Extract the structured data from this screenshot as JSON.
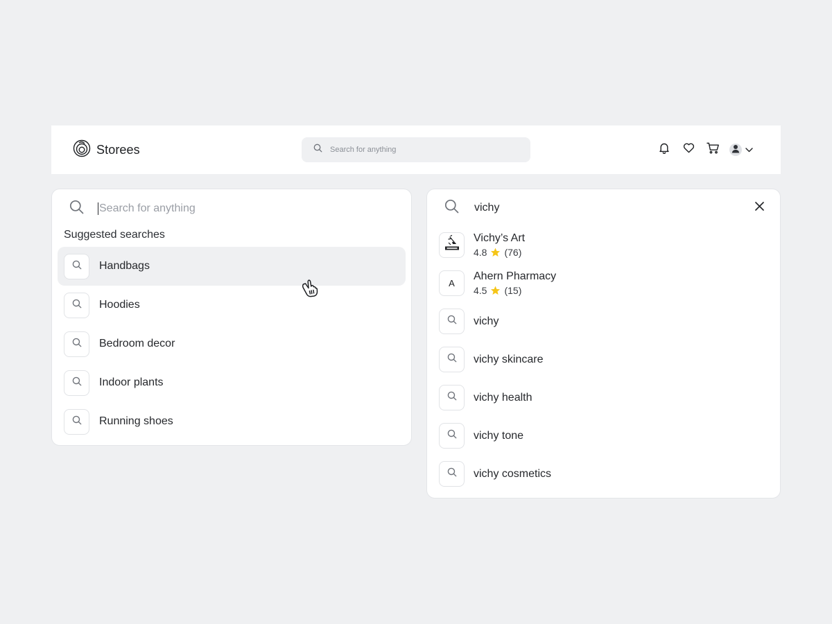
{
  "header": {
    "brand": "Storees",
    "search": {
      "placeholder": "Search for anything",
      "value": ""
    },
    "icons": [
      "bell-icon",
      "heart-icon",
      "cart-icon",
      "user-icon",
      "chevron-down-icon"
    ]
  },
  "left_panel": {
    "search": {
      "placeholder": "Search for anything",
      "value": ""
    },
    "section_label": "Suggested searches",
    "suggestions": [
      {
        "label": "Handbags",
        "active": true
      },
      {
        "label": "Hoodies"
      },
      {
        "label": "Bedroom decor"
      },
      {
        "label": "Indoor plants"
      },
      {
        "label": "Running shoes"
      }
    ]
  },
  "right_panel": {
    "search": {
      "value": "vichy"
    },
    "stores": [
      {
        "name": "Vichy’s Art",
        "rating": "4.8",
        "count": "(76)",
        "thumb": "logo"
      },
      {
        "name": "Ahern Pharmacy",
        "rating": "4.5",
        "count": "(15)",
        "thumb": "A"
      }
    ],
    "queries": [
      {
        "label": "vichy"
      },
      {
        "label": "vichy skincare"
      },
      {
        "label": "vichy health"
      },
      {
        "label": "vichy tone"
      },
      {
        "label": "vichy cosmetics"
      }
    ]
  },
  "colors": {
    "background": "#eff0f2",
    "surface": "#ffffff",
    "star": "#f5c518",
    "text": "#26282c"
  }
}
